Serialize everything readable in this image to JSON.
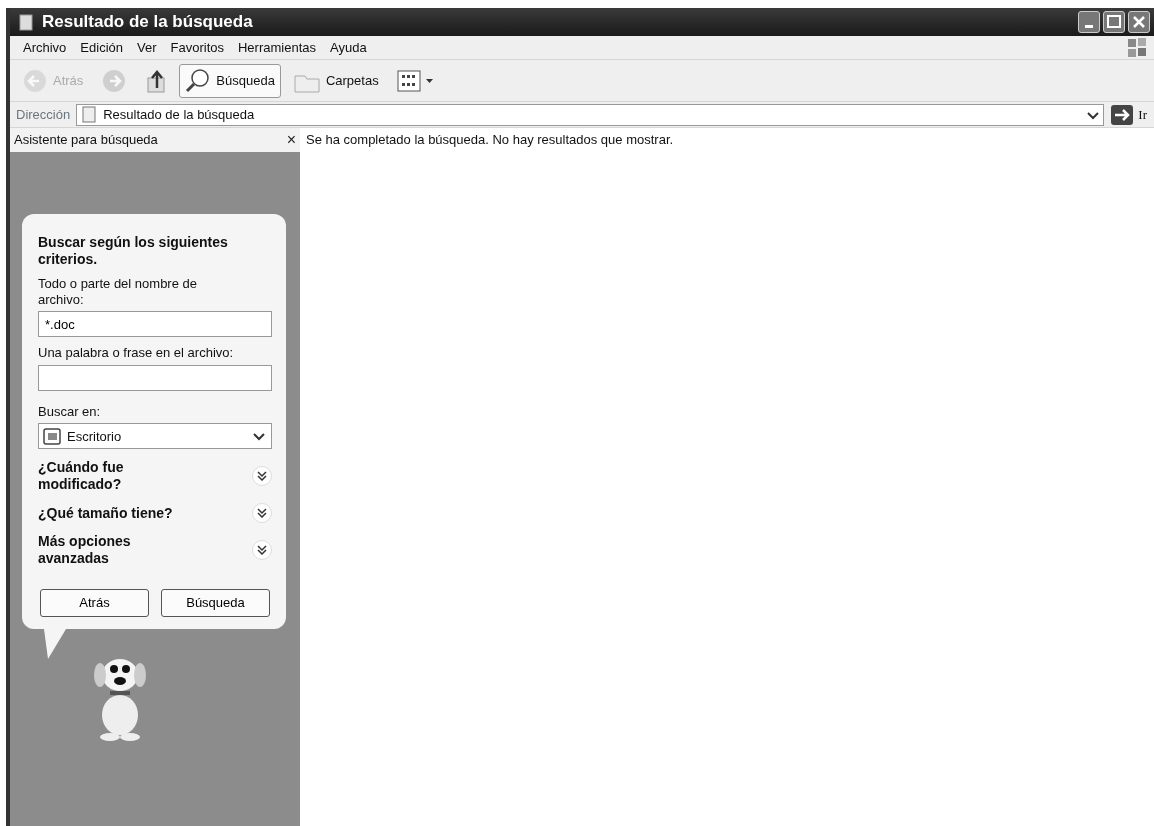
{
  "window": {
    "title": "Resultado de la búsqueda"
  },
  "menu": [
    "Archivo",
    "Edición",
    "Ver",
    "Favoritos",
    "Herramientas",
    "Ayuda"
  ],
  "toolbar": [
    {
      "kind": "back",
      "label": "Atrás",
      "disabled": true,
      "selected": false
    },
    {
      "kind": "forward",
      "disabled": true,
      "selected": false
    },
    {
      "kind": "up",
      "disabled": false,
      "selected": false
    },
    {
      "kind": "search",
      "label": "Búsqueda",
      "disabled": false,
      "selected": true
    },
    {
      "kind": "folders",
      "label": "Carpetas",
      "disabled": false,
      "selected": false
    },
    {
      "kind": "views",
      "disabled": false,
      "selected": false
    }
  ],
  "address": {
    "label": "Dirección",
    "value": "Resultado de la búsqueda",
    "go_label": "Ir"
  },
  "search_pane": {
    "title": "Asistente para búsqueda",
    "close": "×",
    "heading": "Buscar según los siguientes criterios.",
    "fields": [
      {
        "label": "Todo o parte del nombre de archivo:",
        "value": "*.doc"
      },
      {
        "label": "Una palabra o frase en el archivo:"
      }
    ],
    "look_in": {
      "label": "Buscar en:",
      "value": "Escritorio"
    },
    "sections": [
      {
        "label": "¿Cuándo fue modificado?",
        "expanded": false
      },
      {
        "label": "¿Qué tamaño tiene?",
        "expanded": false
      },
      {
        "label": "Más opciones avanzadas",
        "expanded": false
      }
    ],
    "buttons": [
      "Atrás",
      "Búsqueda"
    ]
  },
  "results": {
    "message": "Se ha completado la búsqueda. No hay resultados que mostrar."
  }
}
